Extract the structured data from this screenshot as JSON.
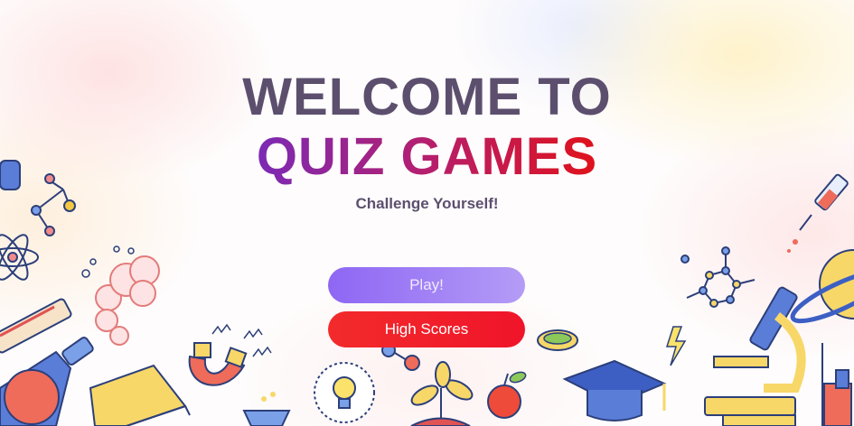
{
  "screen": {
    "title_line1": "WELCOME TO",
    "title_line2": "QUIZ GAMES",
    "subtitle": "Challenge Yourself!"
  },
  "buttons": {
    "play_label": "Play!",
    "high_scores_label": "High Scores"
  },
  "colors": {
    "title_dark": "#5c4f6e",
    "title_gradient_start": "#7b2ab5",
    "title_gradient_end": "#e0121b",
    "play_button": "#8e66f4",
    "high_scores_button": "#f22b2b"
  },
  "illustrations": [
    "atom-icon",
    "molecule-icon",
    "thermometer-icon",
    "flask-icon",
    "magnet-icon",
    "book-icon",
    "lightbulb-icon",
    "plant-icon",
    "apple-icon",
    "graduation-cap-icon",
    "microscope-icon",
    "syringe-icon",
    "planet-icon",
    "lightning-icon",
    "petri-dish-icon"
  ]
}
